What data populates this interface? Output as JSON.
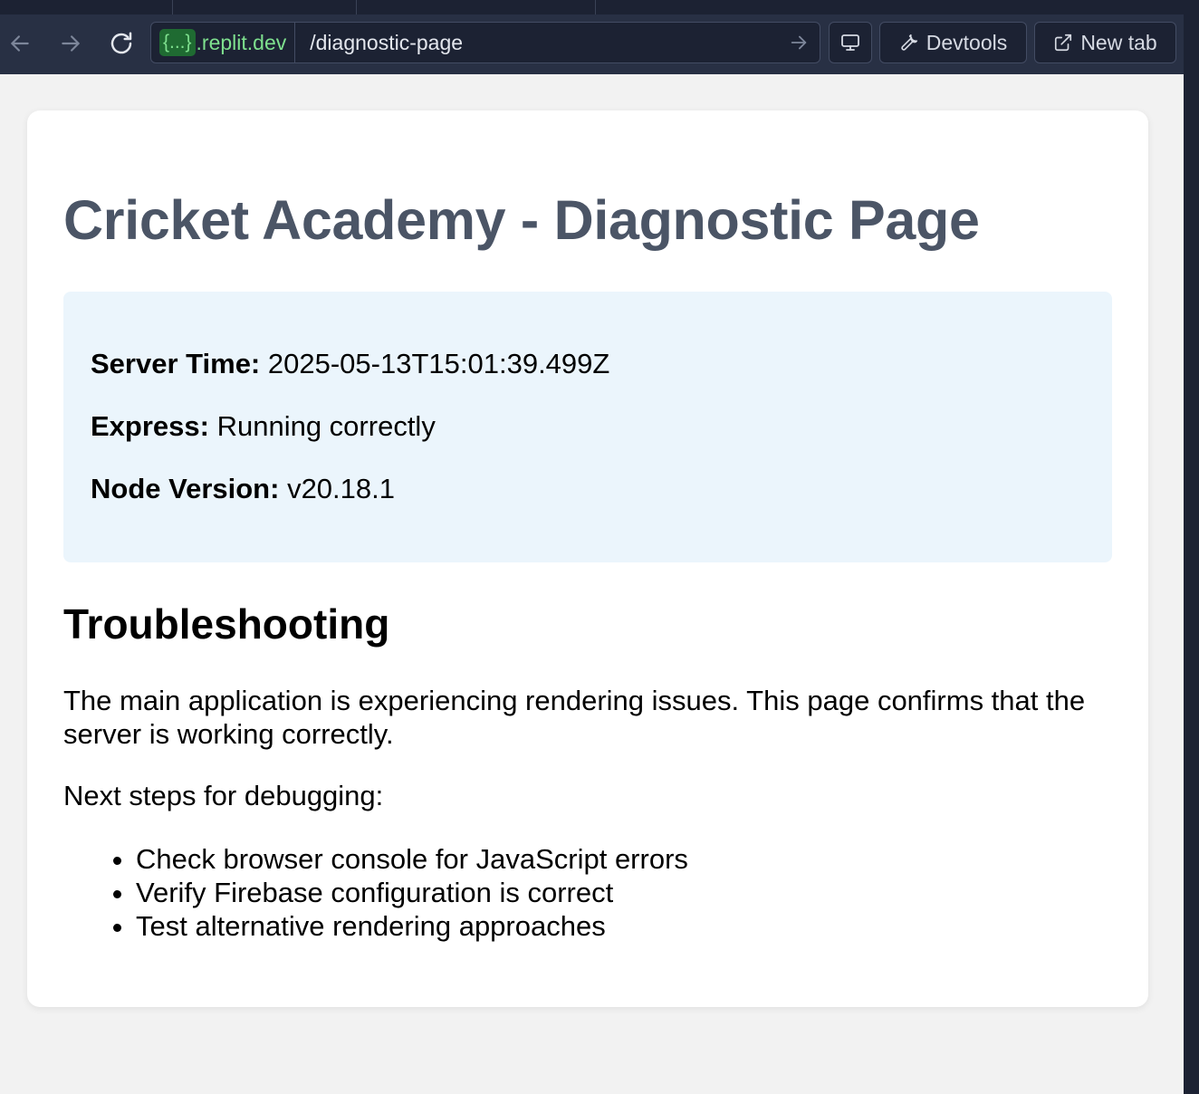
{
  "browser": {
    "domain_badge": "{...}",
    "domain_suffix": ".replit.dev",
    "path": "/diagnostic-page",
    "devtools_label": "Devtools",
    "new_tab_label": "New tab"
  },
  "page": {
    "title": "Cricket Academy - Diagnostic Page",
    "info": {
      "server_time_label": "Server Time:",
      "server_time_value": "2025-05-13T15:01:39.499Z",
      "express_label": "Express:",
      "express_value": "Running correctly",
      "node_label": "Node Version:",
      "node_value": "v20.18.1"
    },
    "troubleshooting": {
      "heading": "Troubleshooting",
      "paragraph": "The main application is experiencing rendering issues. This page confirms that the server is working correctly.",
      "next_steps_label": "Next steps for debugging:",
      "steps": [
        "Check browser console for JavaScript errors",
        "Verify Firebase configuration is correct",
        "Test alternative rendering approaches"
      ]
    }
  },
  "colors": {
    "toolbar_bg": "#283044",
    "domain_green": "#7ee08e",
    "title_color": "#4b5566",
    "info_box_bg": "#ebf5fc"
  }
}
